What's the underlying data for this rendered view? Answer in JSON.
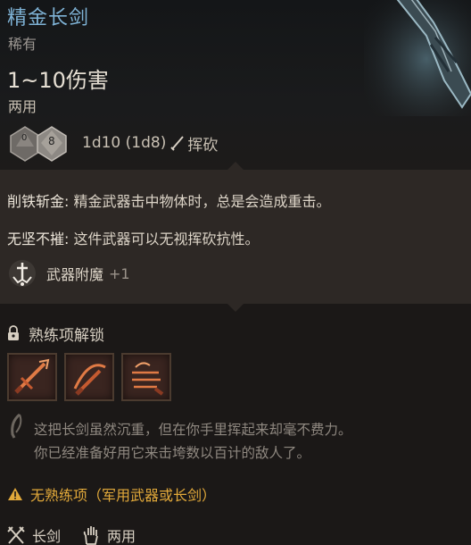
{
  "item": {
    "name": "精金长剑",
    "rarity": "稀有",
    "damage": "1~10伤害",
    "handedness": "两用",
    "dice_top": "0",
    "dice_right": "8",
    "dice_roll": "1d10 (1d8)",
    "damage_type": "挥砍",
    "damage_type_icon": "slashing-icon",
    "name_color": "#7fb3d6"
  },
  "properties": [
    {
      "name": "削铁斩金:",
      "text": " 精金武器击中物体时，总是会造成重击。"
    },
    {
      "name": "无坚不摧:",
      "text": " 这件武器可以无视挥砍抗性。"
    }
  ],
  "enchant": {
    "label": "武器附魔",
    "value": "+1",
    "icon": "weapon-enchant-icon"
  },
  "proficiency": {
    "title": "熟练项解锁",
    "actions": [
      {
        "icon": "slash-action-icon"
      },
      {
        "icon": "cleave-action-icon"
      },
      {
        "icon": "pommel-strike-icon"
      }
    ]
  },
  "description": {
    "line1": "这把长剑虽然沉重，但在你手里挥起来却毫不费力。",
    "line2": "你已经准备好用它来击垮数以百计的敌人了。"
  },
  "warning": {
    "text": "无熟练项（军用武器或长剑）",
    "color": "#e2a93a"
  },
  "footer": {
    "weapon_type": "长剑",
    "hands": "两用"
  }
}
